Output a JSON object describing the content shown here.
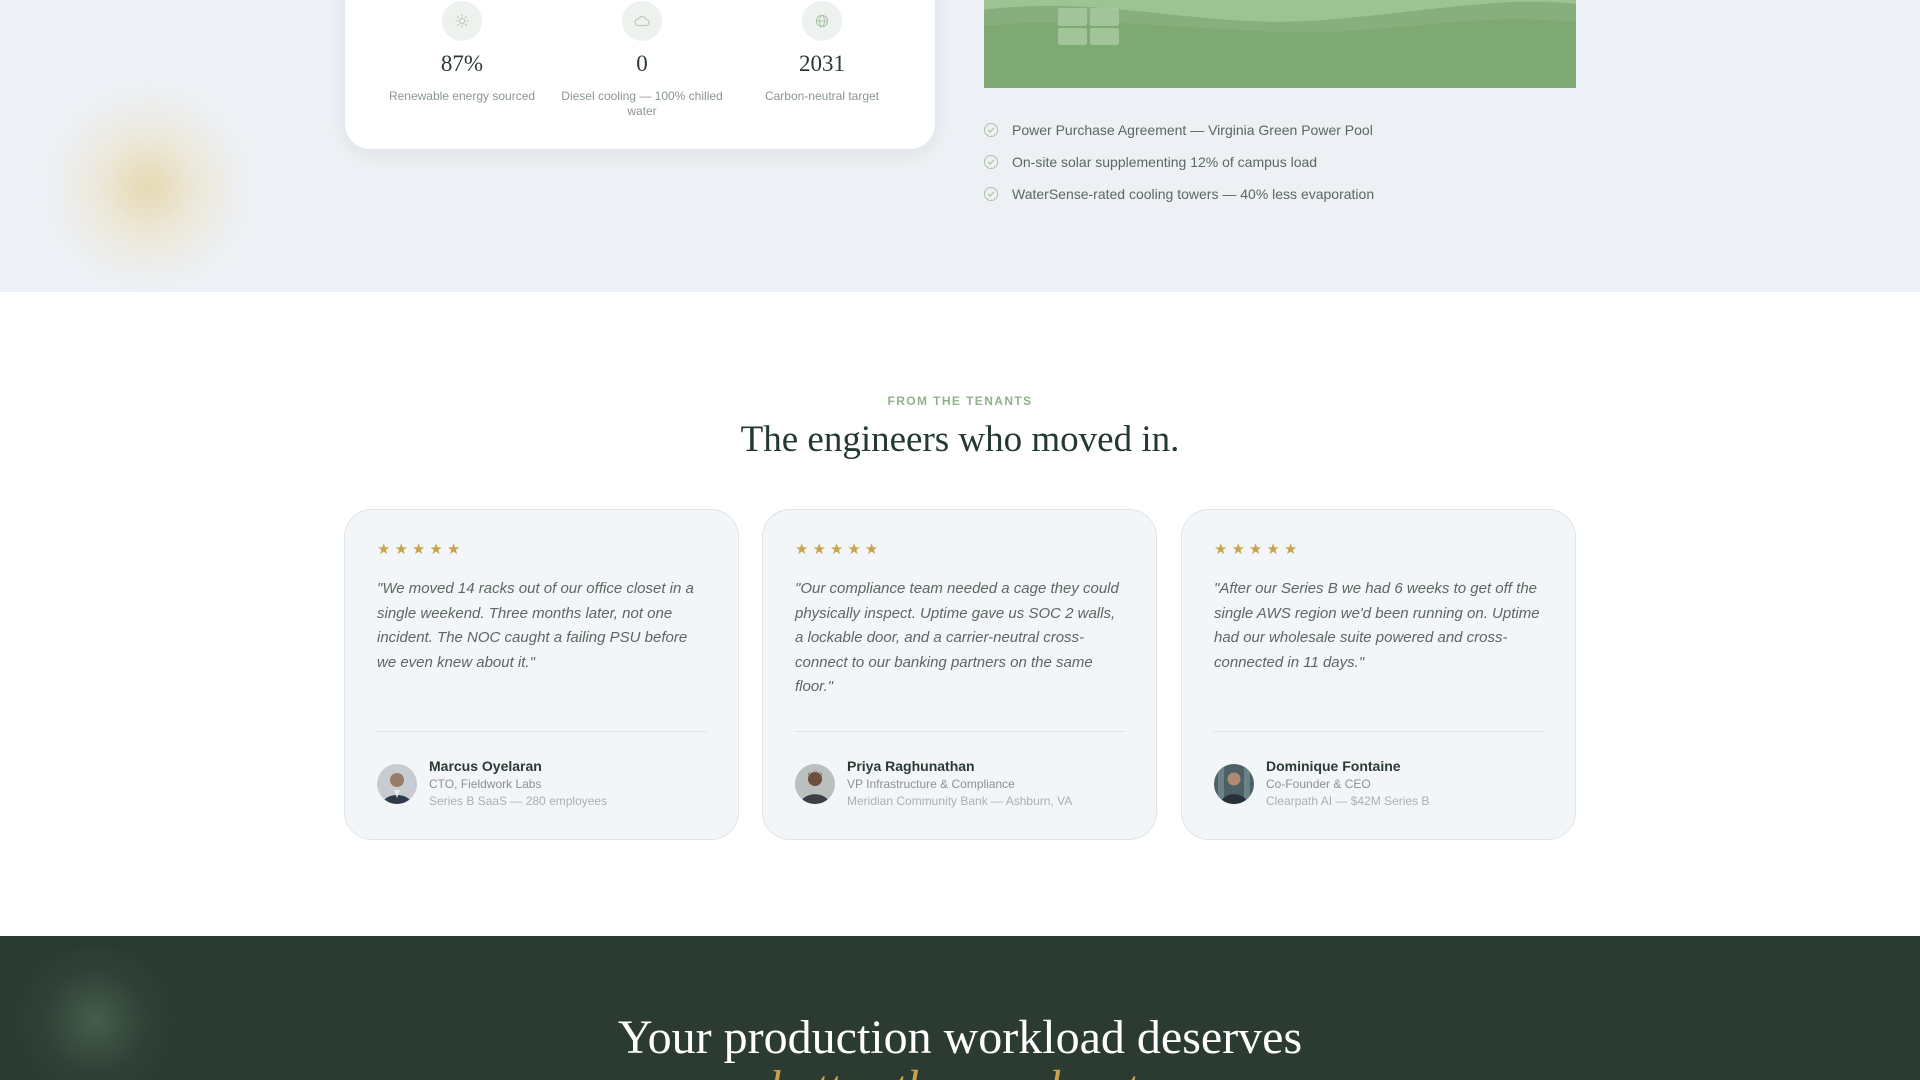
{
  "sustainability": {
    "stats": [
      {
        "icon": "sun-icon",
        "value": "87%",
        "label": "Renewable energy sourced"
      },
      {
        "icon": "cloud-icon",
        "value": "0",
        "label": "Diesel cooling — 100% chilled water"
      },
      {
        "icon": "globe-icon",
        "value": "2031",
        "label": "Carbon-neutral target"
      }
    ],
    "checklist": [
      "Power Purchase Agreement — Virginia Green Power Pool",
      "On-site solar supplementing 12% of campus load",
      "WaterSense-rated cooling towers — 40% less evaporation"
    ]
  },
  "testimonials": {
    "eyebrow": "FROM THE TENANTS",
    "title": "The engineers who moved in.",
    "stars": [
      "★",
      "★",
      "★",
      "★",
      "★"
    ],
    "items": [
      {
        "quote": "\"We moved 14 racks out of our office closet in a single weekend. Three months later, not one incident. The NOC caught a failing PSU before we even knew about it.\"",
        "name": "Marcus Oyelaran",
        "role": "CTO, Fieldwork Labs",
        "company": "Series B SaaS — 280 employees"
      },
      {
        "quote": "\"Our compliance team needed a cage they could physically inspect. Uptime gave us SOC 2 walls, a lockable door, and a carrier-neutral cross-connect to our banking partners on the same floor.\"",
        "name": "Priya Raghunathan",
        "role": "VP Infrastructure & Compliance",
        "company": "Meridian Community Bank — Ashburn, VA"
      },
      {
        "quote": "\"After our Series B we had 6 weeks to get off the single AWS region we'd been running on. Uptime had our wholesale suite powered and cross-connected in 11 days.\"",
        "name": "Dominique Fontaine",
        "role": "Co-Founder & CEO",
        "company": "Clearpath AI — $42M Series B"
      }
    ]
  },
  "cta": {
    "line1": "Your production workload deserves",
    "line2": "better than a closet."
  },
  "colors": {
    "accent_green": "#8fb389",
    "star_gold": "#c9a24a",
    "cta_bg": "#2b3b32"
  }
}
